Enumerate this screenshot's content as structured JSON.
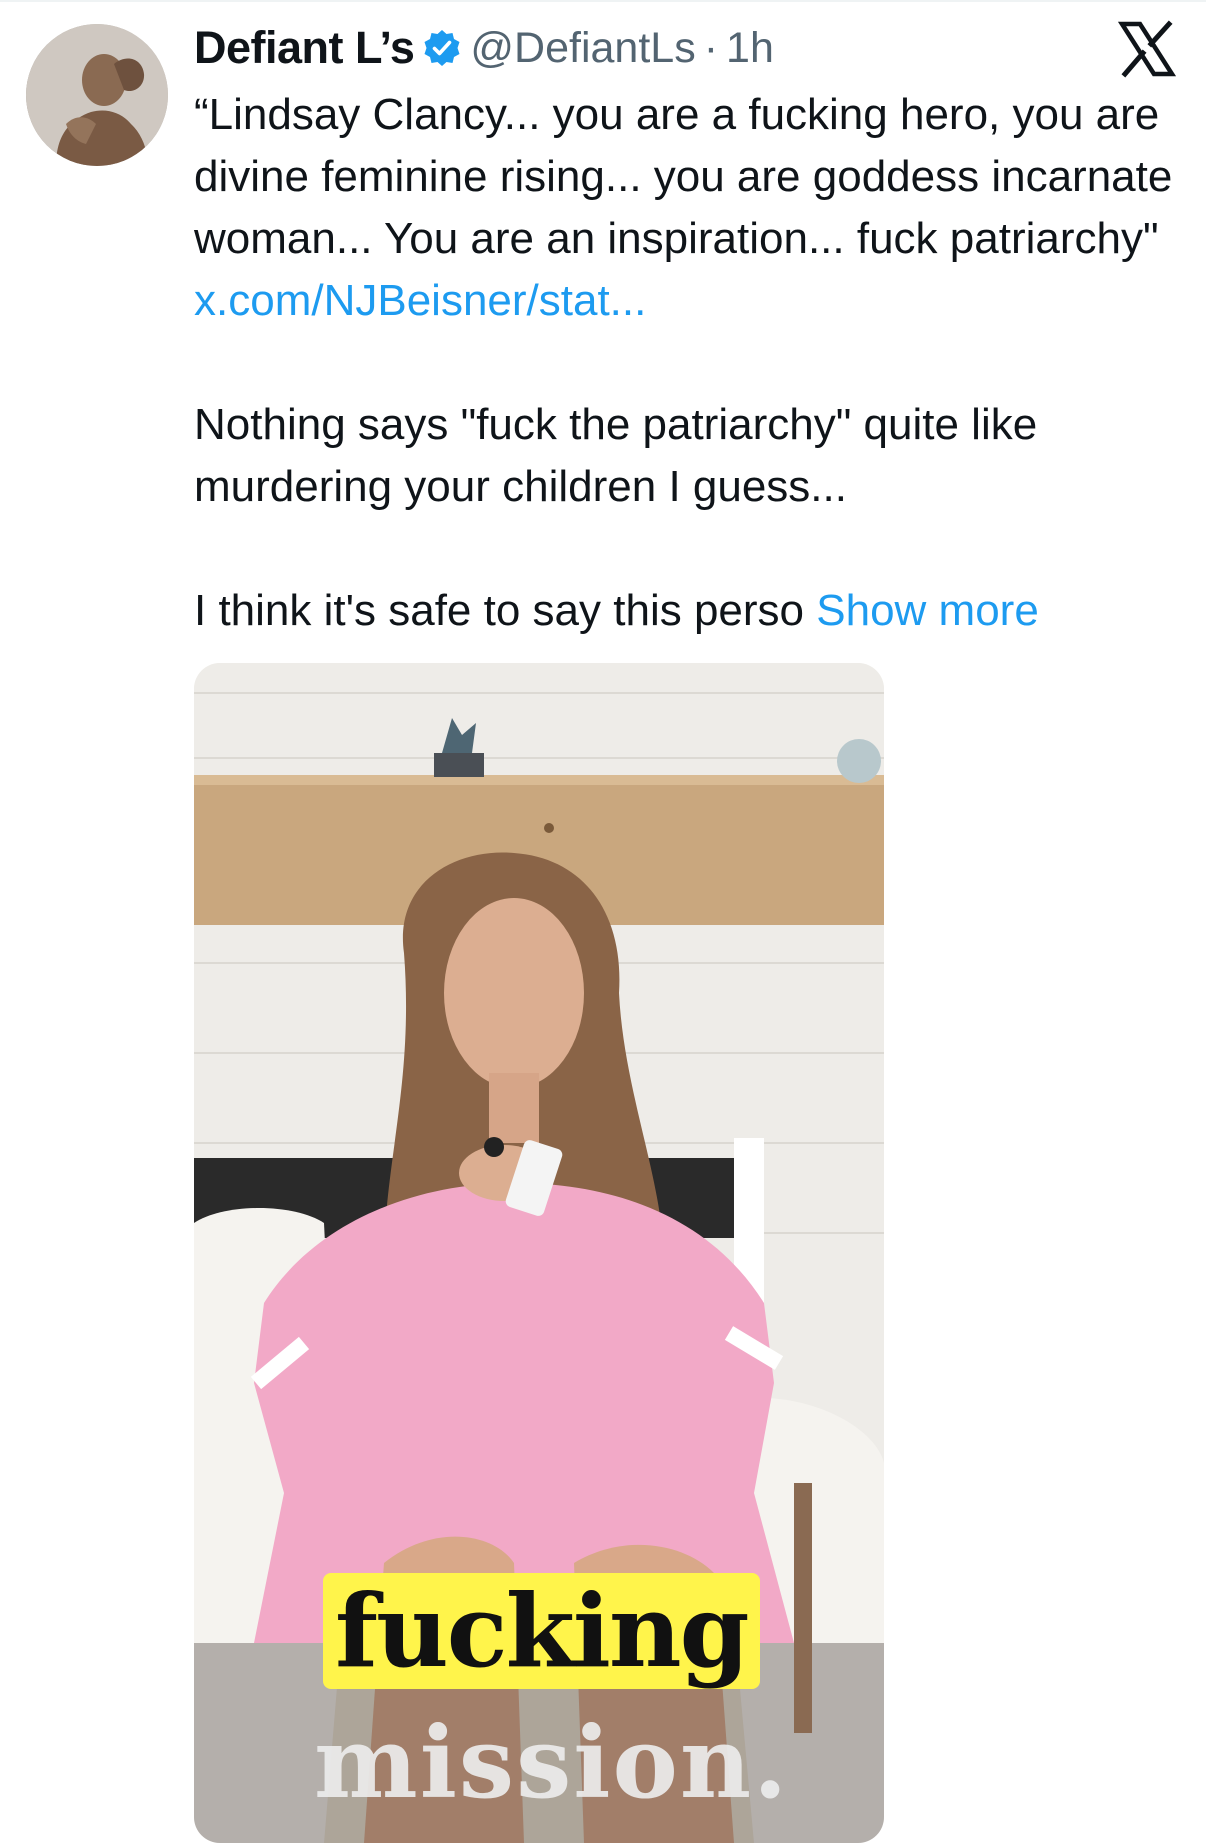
{
  "post": {
    "author_name": "Defiant L’s",
    "author_handle": "@DefiantLs",
    "separator": "·",
    "time": "1h",
    "verified": true,
    "quote_text": "“Lindsay Clancy... you are a fucking hero, you are divine feminine rising... you are goddess incarnate woman... You are an inspiration... fuck patriarchy\"",
    "quote_link": "x.com/NJBeisner/stat...",
    "paragraph_2": "Nothing says \"fuck the patriarchy\" quite like murdering your children I guess...",
    "paragraph_3": "I think it's safe to say this perso",
    "show_more": "Show more"
  },
  "media": {
    "caption_line_1": "fucking",
    "caption_line_2": "mission."
  },
  "icons": {
    "verified": "verified-badge-icon",
    "platform": "x-logo-icon"
  },
  "colors": {
    "link": "#1d9bf0",
    "secondary_text": "#536471",
    "primary_text": "#0f1419",
    "caption_highlight": "#fff44b"
  }
}
